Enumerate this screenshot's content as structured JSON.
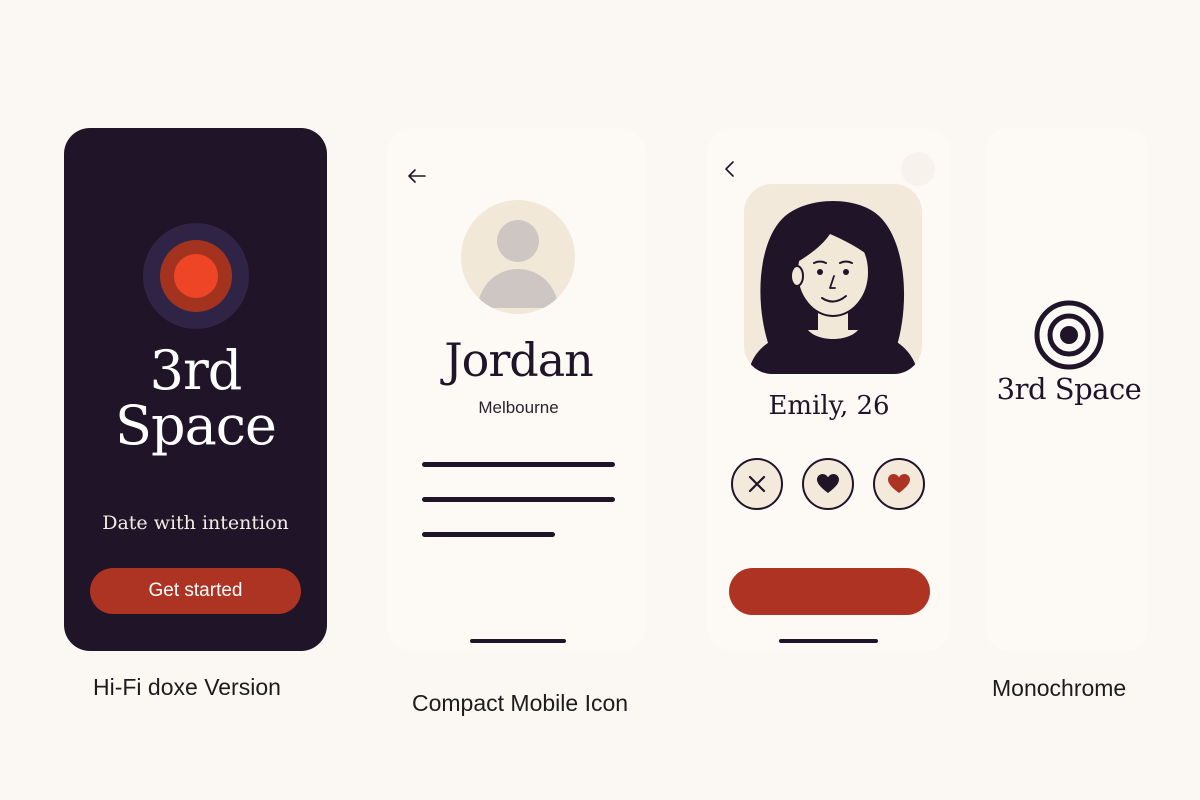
{
  "screens": {
    "splash": {
      "brand_line1": "3rd",
      "brand_line2": "Space",
      "tagline": "Date with intention",
      "cta_label": "Get started",
      "logo_icon": "target-dot-icon"
    },
    "profile": {
      "back_icon": "arrow-left-icon",
      "avatar_icon": "user-avatar-icon",
      "name": "Jordan",
      "location": "Melbourne"
    },
    "match": {
      "back_icon": "chevron-left-icon",
      "name_age": "Emily, 26",
      "actions": [
        "close-icon",
        "heart-icon",
        "heart-icon"
      ]
    },
    "monochrome": {
      "logo_icon": "target-rings-icon",
      "brand": "3rd Space"
    }
  },
  "captions": {
    "hifi": "Hi-Fi doxe Version",
    "compact": "Compact Mobile Icon",
    "mono": "Monochrome"
  },
  "colors": {
    "background": "#fbf8f3",
    "dark": "#201428",
    "accent": "#ad3322",
    "accent_bright": "#ee4527",
    "cream": "#f2e9da"
  }
}
